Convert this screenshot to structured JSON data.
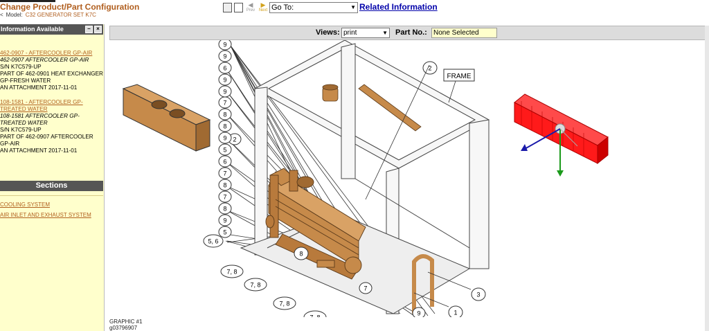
{
  "header": {
    "change_link": "Change Product/Part Configuration",
    "model_label": "Model:",
    "model_value": "C32 GENERATOR SET K7C",
    "nav_prev": "Prev",
    "nav_next": "Next",
    "goto_value": "Go To:",
    "related_link": "Related Information"
  },
  "sidebar": {
    "info_title": "Information Available",
    "entries": [
      {
        "link": "462-0907 - AFTERCOOLER GP-AIR",
        "lines": [
          "462-0907 AFTERCOOLER GP-AIR",
          "S/N K7C579-UP",
          "PART OF 462-0901 HEAT EXCHANGER GP-FRESH WATER",
          "AN ATTACHMENT 2017-11-01"
        ]
      },
      {
        "link": "108-1581 - AFTERCOOLER GP-TREATED WATER",
        "lines": [
          "108-1581 AFTERCOOLER GP-TREATED WATER",
          "S/N K7C579-UP",
          "PART OF 462-0907 AFTERCOOLER GP-AIR",
          "AN ATTACHMENT 2017-11-01"
        ]
      }
    ],
    "sections_title": "Sections",
    "sections": [
      "COOLING SYSTEM",
      "AIR INLET AND EXHAUST SYSTEM"
    ]
  },
  "viewbar": {
    "views_label": "Views:",
    "views_value": "print",
    "partno_label": "Part No.:",
    "partno_value": "None Selected"
  },
  "graphic": {
    "callouts": [
      "9",
      "9",
      "6",
      "9",
      "9",
      "7",
      "8",
      "8",
      "2",
      "9",
      "5",
      "6",
      "7",
      "8",
      "7",
      "8",
      "9",
      "5",
      "5, 6",
      "8",
      "7, 8",
      "7, 8",
      "7, 8",
      "7, 8",
      "2",
      "3",
      "9",
      "1",
      "7"
    ],
    "frame_label": "FRAME",
    "caption_line1": "GRAPHIC #1",
    "caption_line2": "g03796907"
  },
  "colors": {
    "brand_link": "#b05e1e",
    "related_link": "#0000aa",
    "sidebar_bg": "#ffffcc",
    "highlight_part": "#ff1a1a",
    "copper": "#c68a4a"
  }
}
